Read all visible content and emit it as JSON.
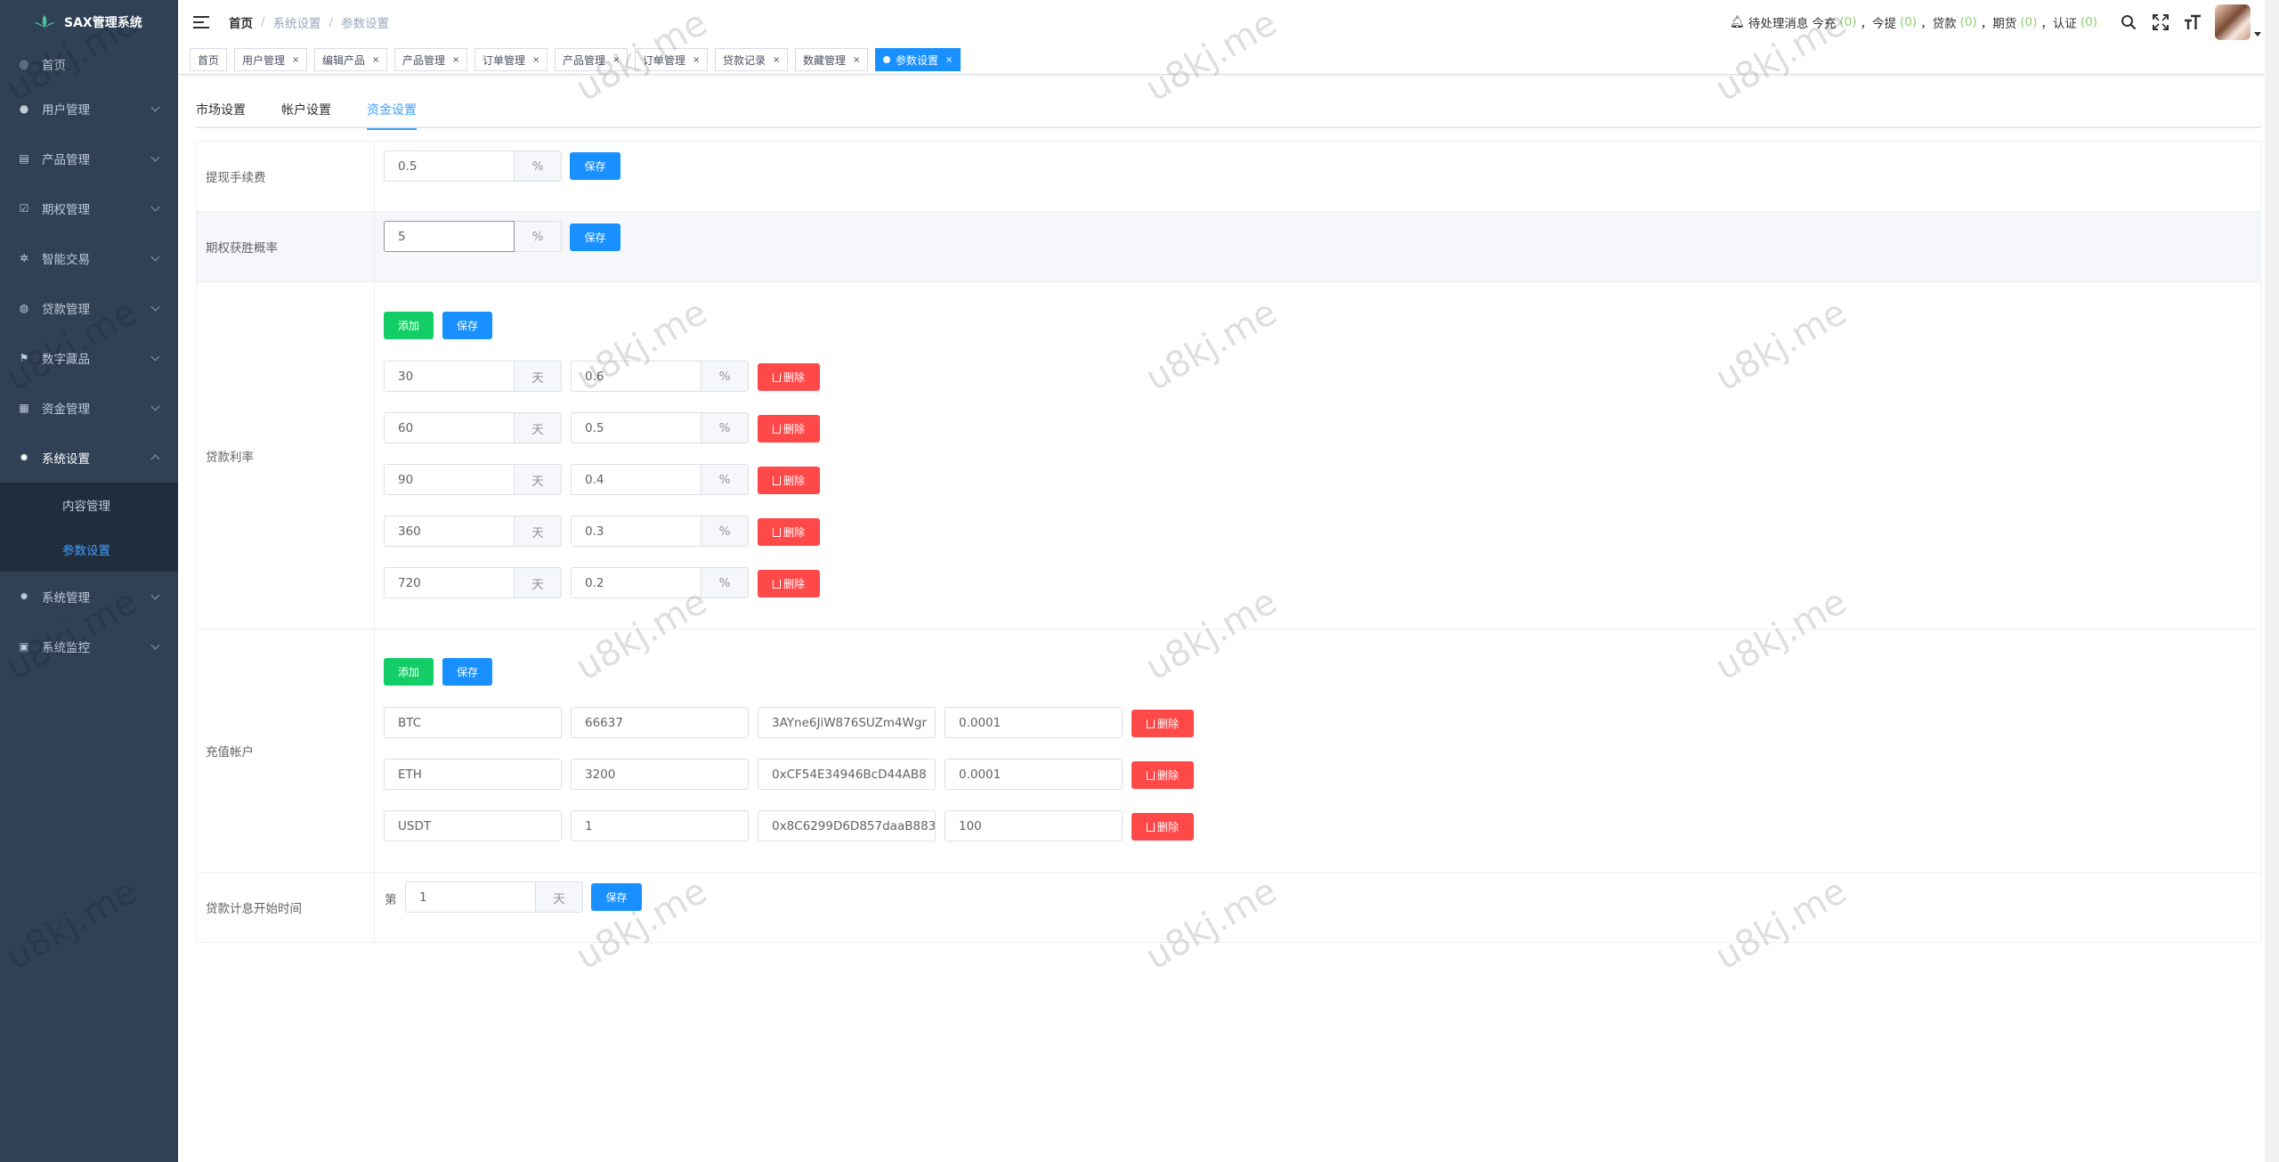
{
  "app": {
    "title": "SAX管理系统"
  },
  "sidebar": {
    "items": [
      {
        "label": "首页",
        "icon": "dashboard-icon"
      },
      {
        "label": "用户管理",
        "icon": "user-icon"
      },
      {
        "label": "产品管理",
        "icon": "product-icon"
      },
      {
        "label": "期权管理",
        "icon": "option-icon"
      },
      {
        "label": "智能交易",
        "icon": "smart-icon"
      },
      {
        "label": "贷款管理",
        "icon": "loan-icon"
      },
      {
        "label": "数字藏品",
        "icon": "nft-icon"
      },
      {
        "label": "资金管理",
        "icon": "fund-icon"
      },
      {
        "label": "系统设置",
        "icon": "gear-icon"
      },
      {
        "label": "系统管理",
        "icon": "gear-icon"
      },
      {
        "label": "系统监控",
        "icon": "monitor-icon"
      }
    ],
    "sub_items": [
      {
        "label": "内容管理"
      },
      {
        "label": "参数设置"
      }
    ]
  },
  "header": {
    "breadcrumb": [
      "首页",
      "系统设置",
      "参数设置"
    ],
    "notice": {
      "label": "待处理消息",
      "items": [
        {
          "label": "今充",
          "count": "(0)"
        },
        {
          "label": "今提",
          "count": "(0)"
        },
        {
          "label": "贷款",
          "count": "(0)"
        },
        {
          "label": "期货",
          "count": "(0)"
        },
        {
          "label": "认证",
          "count": "(0)"
        }
      ],
      "separator": "，"
    }
  },
  "tags": [
    "首页",
    "用户管理",
    "编辑产品",
    "产品管理",
    "订单管理",
    "产品管理",
    "订单管理",
    "贷款记录",
    "数藏管理",
    "参数设置"
  ],
  "tabs": [
    "市场设置",
    "帐户设置",
    "资金设置"
  ],
  "form": {
    "withdraw_fee": {
      "label": "提现手续费",
      "value": "0.5",
      "unit": "%",
      "save": "保存"
    },
    "option_win_rate": {
      "label": "期权获胜概率",
      "value": "5",
      "unit": "%",
      "save": "保存"
    },
    "loan_rate": {
      "label": "贷款利率",
      "add": "添加",
      "save": "保存",
      "day_unit": "天",
      "pct_unit": "%",
      "delete": "删除",
      "rows": [
        {
          "days": "30",
          "rate": "0.6"
        },
        {
          "days": "60",
          "rate": "0.5"
        },
        {
          "days": "90",
          "rate": "0.4"
        },
        {
          "days": "360",
          "rate": "0.3"
        },
        {
          "days": "720",
          "rate": "0.2"
        }
      ]
    },
    "recharge": {
      "label": "充值帐户",
      "add": "添加",
      "save": "保存",
      "delete": "删除",
      "rows": [
        {
          "coin": "BTC",
          "price": "66637",
          "address": "3AYne6JiW876SUZm4Wgr",
          "min": "0.0001"
        },
        {
          "coin": "ETH",
          "price": "3200",
          "address": "0xCF54E34946BcD44AB8",
          "min": "0.0001"
        },
        {
          "coin": "USDT",
          "price": "1",
          "address": "0x8C6299D6D857daaB883",
          "min": "100"
        }
      ]
    },
    "loan_start": {
      "label": "贷款计息开始时间",
      "prefix": "第",
      "value": "1",
      "unit": "天",
      "save": "保存"
    }
  },
  "watermark": "u8kj.me"
}
